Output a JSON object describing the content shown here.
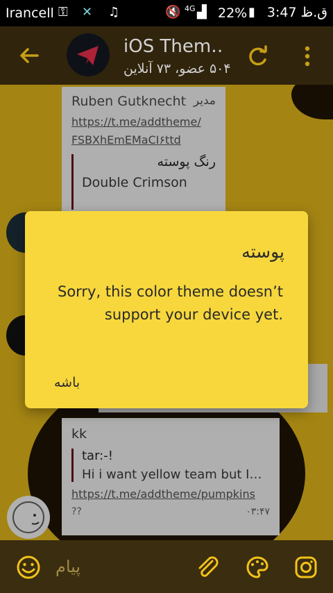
{
  "status_bar": {
    "carrier": "Irancell",
    "network": "4G",
    "battery": "22%",
    "time": "3:47 ق.ظ"
  },
  "header": {
    "title": "iOS Them…",
    "subtitle": "۵۰۴ عضو، ۷۳ آنلاین"
  },
  "chat": {
    "first_message": {
      "sender": "Ruben Gutknecht",
      "role": "مدیر",
      "link": "https://t.me/addtheme/FSBXhEmEMaCI۶ttd",
      "link_line1": "https://t.me/addtheme/",
      "link_line2": "FSBXhEmEMaCI۶ttd",
      "quote_title": "رنگ پوسته",
      "quote_text": "Double Crimson"
    },
    "second_message": {
      "sender": "kk",
      "reply_name": "tar:-!",
      "reply_text": "Hi  i want yellow team but I…",
      "link": "https://t.me/addtheme/pumpkins",
      "body": "??",
      "time": "۰۳:۴۷"
    }
  },
  "dialog": {
    "title": "پوسته",
    "message": "Sorry, this color theme doesn’t support your device yet.",
    "ok_button": "باشه"
  },
  "composer": {
    "placeholder": "پیام"
  },
  "colors": {
    "appbar": "#3b2d0f",
    "accent": "#f2c31a",
    "dialog_bg": "#f7d73c",
    "wallpaper": "#c9a318"
  }
}
